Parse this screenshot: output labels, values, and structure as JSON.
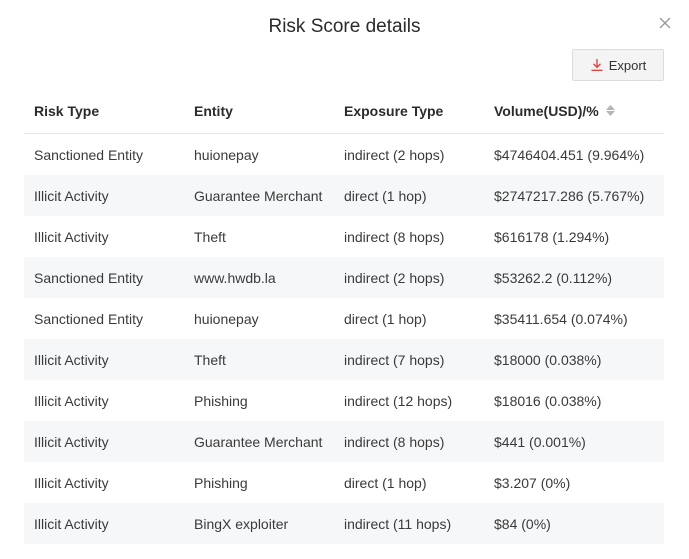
{
  "dialog": {
    "title": "Risk Score details",
    "export_label": "Export",
    "accent_color": "#e53935"
  },
  "table": {
    "headers": [
      "Risk Type",
      "Entity",
      "Exposure Type",
      "Volume(USD)/%"
    ],
    "rows": [
      [
        "Sanctioned Entity",
        "huionepay",
        "indirect (2 hops)",
        "$4746404.451 (9.964%)"
      ],
      [
        "Illicit Activity",
        "Guarantee Merchant",
        "direct (1 hop)",
        "$2747217.286 (5.767%)"
      ],
      [
        "Illicit Activity",
        "Theft",
        "indirect (8 hops)",
        "$616178 (1.294%)"
      ],
      [
        "Sanctioned Entity",
        "www.hwdb.la",
        "indirect (2 hops)",
        "$53262.2 (0.112%)"
      ],
      [
        "Sanctioned Entity",
        "huionepay",
        "direct (1 hop)",
        "$35411.654 (0.074%)"
      ],
      [
        "Illicit Activity",
        "Theft",
        "indirect (7 hops)",
        "$18000 (0.038%)"
      ],
      [
        "Illicit Activity",
        "Phishing",
        "indirect (12 hops)",
        "$18016 (0.038%)"
      ],
      [
        "Illicit Activity",
        "Guarantee Merchant",
        "indirect (8 hops)",
        "$441 (0.001%)"
      ],
      [
        "Illicit Activity",
        "Phishing",
        "direct (1 hop)",
        "$3.207 (0%)"
      ],
      [
        "Illicit Activity",
        "BingX exploiter",
        "indirect (11 hops)",
        "$84 (0%)"
      ]
    ]
  }
}
